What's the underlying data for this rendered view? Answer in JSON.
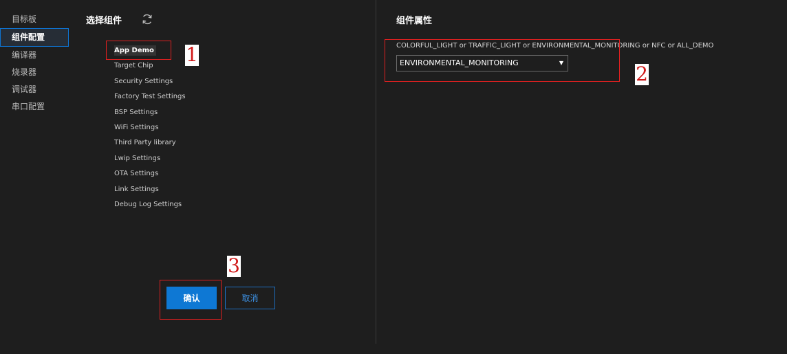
{
  "nav": {
    "items": [
      {
        "label": "目标板"
      },
      {
        "label": "组件配置"
      },
      {
        "label": "编译器"
      },
      {
        "label": "烧录器"
      },
      {
        "label": "调试器"
      },
      {
        "label": "串口配置"
      }
    ],
    "active": "组件配置"
  },
  "components": {
    "title": "选择组件",
    "refresh_icon": "refresh-icon",
    "items": [
      {
        "label": "App Demo"
      },
      {
        "label": "Target Chip"
      },
      {
        "label": "Security Settings"
      },
      {
        "label": "Factory Test Settings"
      },
      {
        "label": "BSP Settings"
      },
      {
        "label": "WiFi Settings"
      },
      {
        "label": "Third Party library"
      },
      {
        "label": "Lwip Settings"
      },
      {
        "label": "OTA Settings"
      },
      {
        "label": "Link Settings"
      },
      {
        "label": "Debug Log Settings"
      }
    ],
    "selected": "App Demo"
  },
  "buttons": {
    "confirm": "确认",
    "cancel": "取消"
  },
  "properties": {
    "title": "组件属性",
    "field_label": "COLORFUL_LIGHT or TRAFFIC_LIGHT or ENVIRONMENTAL_MONITORING or NFC or ALL_DEMO",
    "selected_value": "ENVIRONMENTAL_MONITORING",
    "arrow": "▼"
  },
  "annotations": {
    "one": "1",
    "two": "2",
    "three": "3"
  },
  "colors": {
    "background": "#1e1e1e",
    "accent": "#0e78d4",
    "annotation": "#e02020"
  }
}
